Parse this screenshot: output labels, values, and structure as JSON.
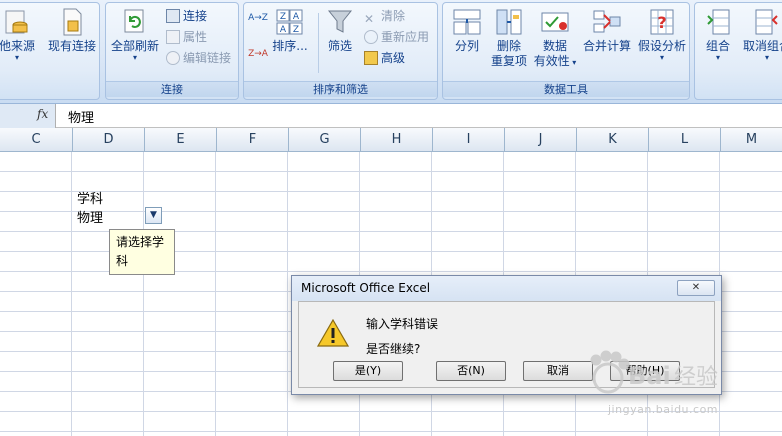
{
  "ribbon": {
    "other_sources": "他来源",
    "existing_conn": "现有连接",
    "refresh_all": "全部刷新",
    "connections": "连接",
    "properties": "属性",
    "edit_links": "编辑链接",
    "connections_group": "连接",
    "sort_asc": "A→Z",
    "sort_desc": "Z→A",
    "sort": "排序...",
    "filter": "筛选",
    "clear": "清除",
    "reapply": "重新应用",
    "advanced": "高级",
    "sort_filter_group": "排序和筛选",
    "split": "分列",
    "remove_dup_1": "删除",
    "remove_dup_2": "重复项",
    "validation_1": "数据",
    "validation_2": "有效性",
    "consolidate": "合并计算",
    "whatif": "假设分析",
    "data_tools_group": "数据工具",
    "group": "组合",
    "ungroup": "取消组合"
  },
  "formula_bar": {
    "fx": "fx",
    "content": "物理"
  },
  "columns": [
    "C",
    "D",
    "E",
    "F",
    "G",
    "H",
    "I",
    "J",
    "K",
    "L",
    "M"
  ],
  "cells": {
    "d_label": "学科",
    "d_value": "物理"
  },
  "tooltip": {
    "line1": "请选择学",
    "line2": "科"
  },
  "dialog": {
    "title": "Microsoft Office Excel",
    "close": "✕",
    "message1": "输入学科错误",
    "message2": "是否继续?",
    "yes": "是(Y)",
    "no": "否(N)",
    "cancel": "取消",
    "help": "帮助(H)"
  },
  "watermark": {
    "url": "jingyan.baidu.com"
  }
}
